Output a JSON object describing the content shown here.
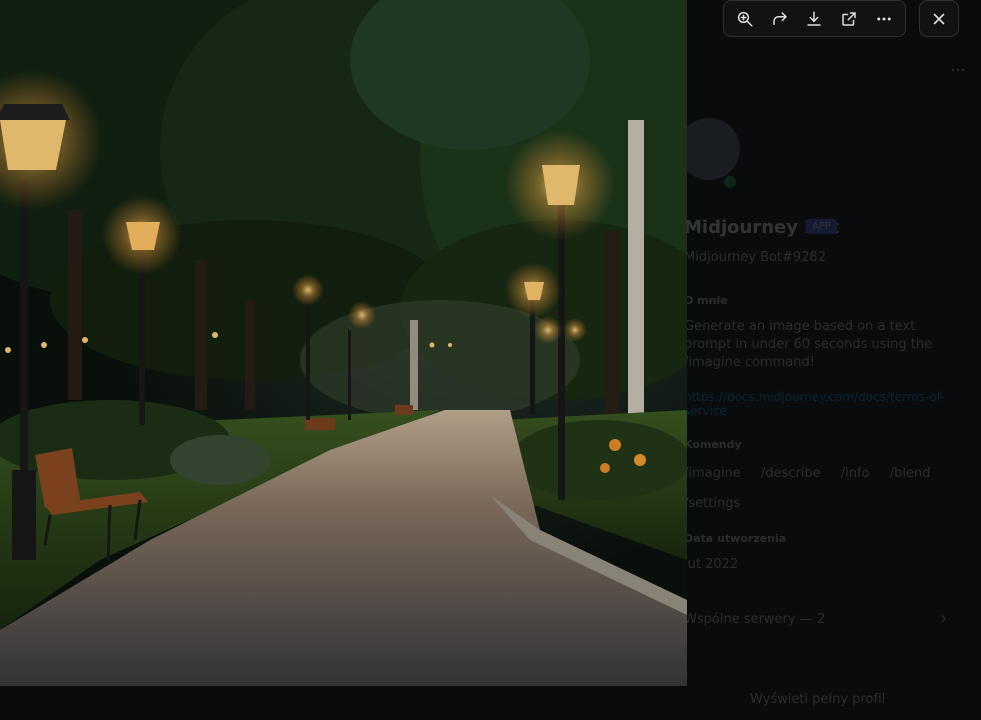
{
  "viewer": {
    "image_alt": "Night park path with glowing street lamps and benches",
    "toolbar": [
      {
        "name": "zoom-in-icon"
      },
      {
        "name": "forward-icon"
      },
      {
        "name": "download-icon"
      },
      {
        "name": "open-external-icon"
      },
      {
        "name": "more-options-icon"
      }
    ],
    "close_icon": "close-icon"
  },
  "profile": {
    "display_name": "Midjourney Bot",
    "badge": "APP",
    "username": "Midjourney Bot#9282",
    "about_header": "O mnie",
    "about_text": "Generate an image based on a text prompt in under 60 seconds using the /imagine command!",
    "about_link": "https://docs.midjourney.com/docs/terms-of-service",
    "commands_header": "Komendy",
    "commands": [
      "/imagine",
      "/describe",
      "/info",
      "/blend",
      "/settings"
    ],
    "created_header": "Data utworzenia",
    "created_value": "lut 2022",
    "mutual_servers": "Wspólne serwery — 2",
    "view_full": "Wyświetl pełny profil"
  },
  "colors": {
    "lamp_glow": "#ffd27a",
    "foliage": "#1c3a1c",
    "path": "#6e6258",
    "toolbar_bg": "#111214"
  }
}
